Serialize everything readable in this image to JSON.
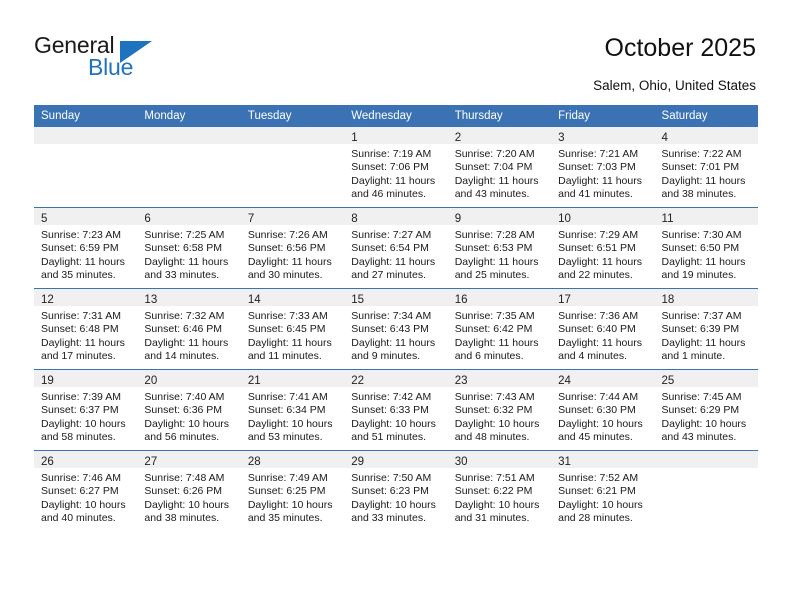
{
  "brand": {
    "name_top": "General",
    "name_bottom": "Blue",
    "accent_color": "#1f72bd"
  },
  "header": {
    "title": "October 2025",
    "subtitle": "Salem, Ohio, United States"
  },
  "theme": {
    "header_row_color": "#3b72b4",
    "daynum_band_color": "#f0f0f0",
    "grid_line_color": "#3b72b4",
    "text_color": "#1a1a1a"
  },
  "weekday_headers": [
    "Sunday",
    "Monday",
    "Tuesday",
    "Wednesday",
    "Thursday",
    "Friday",
    "Saturday"
  ],
  "calendar": {
    "weeks": [
      [
        {
          "day": "",
          "empty": true,
          "lines": []
        },
        {
          "day": "",
          "empty": true,
          "lines": []
        },
        {
          "day": "",
          "empty": true,
          "lines": []
        },
        {
          "day": "1",
          "empty": false,
          "lines": [
            "Sunrise: 7:19 AM",
            "Sunset: 7:06 PM",
            "Daylight: 11 hours",
            "and 46 minutes."
          ]
        },
        {
          "day": "2",
          "empty": false,
          "lines": [
            "Sunrise: 7:20 AM",
            "Sunset: 7:04 PM",
            "Daylight: 11 hours",
            "and 43 minutes."
          ]
        },
        {
          "day": "3",
          "empty": false,
          "lines": [
            "Sunrise: 7:21 AM",
            "Sunset: 7:03 PM",
            "Daylight: 11 hours",
            "and 41 minutes."
          ]
        },
        {
          "day": "4",
          "empty": false,
          "lines": [
            "Sunrise: 7:22 AM",
            "Sunset: 7:01 PM",
            "Daylight: 11 hours",
            "and 38 minutes."
          ]
        }
      ],
      [
        {
          "day": "5",
          "empty": false,
          "lines": [
            "Sunrise: 7:23 AM",
            "Sunset: 6:59 PM",
            "Daylight: 11 hours",
            "and 35 minutes."
          ]
        },
        {
          "day": "6",
          "empty": false,
          "lines": [
            "Sunrise: 7:25 AM",
            "Sunset: 6:58 PM",
            "Daylight: 11 hours",
            "and 33 minutes."
          ]
        },
        {
          "day": "7",
          "empty": false,
          "lines": [
            "Sunrise: 7:26 AM",
            "Sunset: 6:56 PM",
            "Daylight: 11 hours",
            "and 30 minutes."
          ]
        },
        {
          "day": "8",
          "empty": false,
          "lines": [
            "Sunrise: 7:27 AM",
            "Sunset: 6:54 PM",
            "Daylight: 11 hours",
            "and 27 minutes."
          ]
        },
        {
          "day": "9",
          "empty": false,
          "lines": [
            "Sunrise: 7:28 AM",
            "Sunset: 6:53 PM",
            "Daylight: 11 hours",
            "and 25 minutes."
          ]
        },
        {
          "day": "10",
          "empty": false,
          "lines": [
            "Sunrise: 7:29 AM",
            "Sunset: 6:51 PM",
            "Daylight: 11 hours",
            "and 22 minutes."
          ]
        },
        {
          "day": "11",
          "empty": false,
          "lines": [
            "Sunrise: 7:30 AM",
            "Sunset: 6:50 PM",
            "Daylight: 11 hours",
            "and 19 minutes."
          ]
        }
      ],
      [
        {
          "day": "12",
          "empty": false,
          "lines": [
            "Sunrise: 7:31 AM",
            "Sunset: 6:48 PM",
            "Daylight: 11 hours",
            "and 17 minutes."
          ]
        },
        {
          "day": "13",
          "empty": false,
          "lines": [
            "Sunrise: 7:32 AM",
            "Sunset: 6:46 PM",
            "Daylight: 11 hours",
            "and 14 minutes."
          ]
        },
        {
          "day": "14",
          "empty": false,
          "lines": [
            "Sunrise: 7:33 AM",
            "Sunset: 6:45 PM",
            "Daylight: 11 hours",
            "and 11 minutes."
          ]
        },
        {
          "day": "15",
          "empty": false,
          "lines": [
            "Sunrise: 7:34 AM",
            "Sunset: 6:43 PM",
            "Daylight: 11 hours",
            "and 9 minutes."
          ]
        },
        {
          "day": "16",
          "empty": false,
          "lines": [
            "Sunrise: 7:35 AM",
            "Sunset: 6:42 PM",
            "Daylight: 11 hours",
            "and 6 minutes."
          ]
        },
        {
          "day": "17",
          "empty": false,
          "lines": [
            "Sunrise: 7:36 AM",
            "Sunset: 6:40 PM",
            "Daylight: 11 hours",
            "and 4 minutes."
          ]
        },
        {
          "day": "18",
          "empty": false,
          "lines": [
            "Sunrise: 7:37 AM",
            "Sunset: 6:39 PM",
            "Daylight: 11 hours",
            "and 1 minute."
          ]
        }
      ],
      [
        {
          "day": "19",
          "empty": false,
          "lines": [
            "Sunrise: 7:39 AM",
            "Sunset: 6:37 PM",
            "Daylight: 10 hours",
            "and 58 minutes."
          ]
        },
        {
          "day": "20",
          "empty": false,
          "lines": [
            "Sunrise: 7:40 AM",
            "Sunset: 6:36 PM",
            "Daylight: 10 hours",
            "and 56 minutes."
          ]
        },
        {
          "day": "21",
          "empty": false,
          "lines": [
            "Sunrise: 7:41 AM",
            "Sunset: 6:34 PM",
            "Daylight: 10 hours",
            "and 53 minutes."
          ]
        },
        {
          "day": "22",
          "empty": false,
          "lines": [
            "Sunrise: 7:42 AM",
            "Sunset: 6:33 PM",
            "Daylight: 10 hours",
            "and 51 minutes."
          ]
        },
        {
          "day": "23",
          "empty": false,
          "lines": [
            "Sunrise: 7:43 AM",
            "Sunset: 6:32 PM",
            "Daylight: 10 hours",
            "and 48 minutes."
          ]
        },
        {
          "day": "24",
          "empty": false,
          "lines": [
            "Sunrise: 7:44 AM",
            "Sunset: 6:30 PM",
            "Daylight: 10 hours",
            "and 45 minutes."
          ]
        },
        {
          "day": "25",
          "empty": false,
          "lines": [
            "Sunrise: 7:45 AM",
            "Sunset: 6:29 PM",
            "Daylight: 10 hours",
            "and 43 minutes."
          ]
        }
      ],
      [
        {
          "day": "26",
          "empty": false,
          "lines": [
            "Sunrise: 7:46 AM",
            "Sunset: 6:27 PM",
            "Daylight: 10 hours",
            "and 40 minutes."
          ]
        },
        {
          "day": "27",
          "empty": false,
          "lines": [
            "Sunrise: 7:48 AM",
            "Sunset: 6:26 PM",
            "Daylight: 10 hours",
            "and 38 minutes."
          ]
        },
        {
          "day": "28",
          "empty": false,
          "lines": [
            "Sunrise: 7:49 AM",
            "Sunset: 6:25 PM",
            "Daylight: 10 hours",
            "and 35 minutes."
          ]
        },
        {
          "day": "29",
          "empty": false,
          "lines": [
            "Sunrise: 7:50 AM",
            "Sunset: 6:23 PM",
            "Daylight: 10 hours",
            "and 33 minutes."
          ]
        },
        {
          "day": "30",
          "empty": false,
          "lines": [
            "Sunrise: 7:51 AM",
            "Sunset: 6:22 PM",
            "Daylight: 10 hours",
            "and 31 minutes."
          ]
        },
        {
          "day": "31",
          "empty": false,
          "lines": [
            "Sunrise: 7:52 AM",
            "Sunset: 6:21 PM",
            "Daylight: 10 hours",
            "and 28 minutes."
          ]
        },
        {
          "day": "",
          "empty": true,
          "lines": []
        }
      ]
    ]
  }
}
